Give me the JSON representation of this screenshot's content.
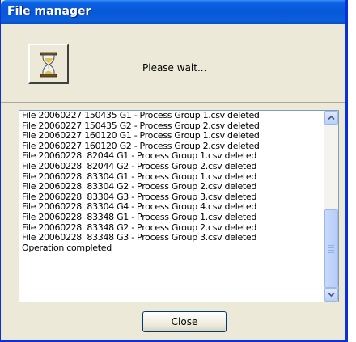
{
  "window": {
    "title": "File manager"
  },
  "status": {
    "icon": "hourglass-icon",
    "message": "Please wait..."
  },
  "log": {
    "lines": [
      "File 20060227 150435 G1 - Process Group 1.csv deleted",
      "File 20060227 150435 G2 - Process Group 2.csv deleted",
      "File 20060227 160120 G1 - Process Group 1.csv deleted",
      "File 20060227 160120 G2 - Process Group 2.csv deleted",
      "File 20060228  82044 G1 - Process Group 1.csv deleted",
      "File 20060228  82044 G2 - Process Group 2.csv deleted",
      "File 20060228  83304 G1 - Process Group 1.csv deleted",
      "File 20060228  83304 G2 - Process Group 2.csv deleted",
      "File 20060228  83304 G3 - Process Group 3.csv deleted",
      "File 20060228  83304 G4 - Process Group 4.csv deleted",
      "File 20060228  83348 G1 - Process Group 1.csv deleted",
      "File 20060228  83348 G2 - Process Group 2.csv deleted",
      "File 20060228  83348 G3 - Process Group 3.csv deleted",
      "Operation completed"
    ]
  },
  "buttons": {
    "close_label": "Close"
  },
  "colors": {
    "titlebar": "#0758d6",
    "dialog_bg": "#ece9d8",
    "list_border": "#7f9db9"
  }
}
